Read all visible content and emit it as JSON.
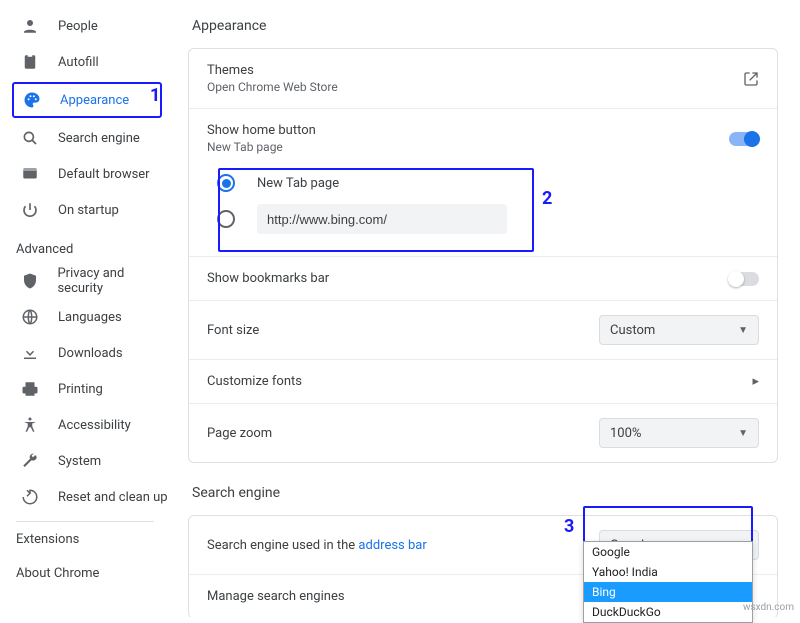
{
  "sidebar": {
    "items": [
      {
        "label": "People"
      },
      {
        "label": "Autofill"
      },
      {
        "label": "Appearance"
      },
      {
        "label": "Search engine"
      },
      {
        "label": "Default browser"
      },
      {
        "label": "On startup"
      }
    ],
    "advanced_label": "Advanced",
    "advanced": [
      {
        "label": "Privacy and security"
      },
      {
        "label": "Languages"
      },
      {
        "label": "Downloads"
      },
      {
        "label": "Printing"
      },
      {
        "label": "Accessibility"
      },
      {
        "label": "System"
      },
      {
        "label": "Reset and clean up"
      }
    ],
    "footer": {
      "extensions": "Extensions",
      "about": "About Chrome"
    }
  },
  "appearance": {
    "title": "Appearance",
    "themes": {
      "title": "Themes",
      "sub": "Open Chrome Web Store"
    },
    "home_button": {
      "title": "Show home button",
      "sub": "New Tab page",
      "opt_newtab": "New Tab page",
      "url_value": "http://www.bing.com/"
    },
    "bookmarks": "Show bookmarks bar",
    "font_size": {
      "label": "Font size",
      "value": "Custom"
    },
    "custom_fonts": "Customize fonts",
    "page_zoom": {
      "label": "Page zoom",
      "value": "100%"
    }
  },
  "search_engine": {
    "title": "Search engine",
    "row_prefix": "Search engine used in the ",
    "row_link": "address bar",
    "value": "Google",
    "manage": "Manage search engines",
    "options": [
      "Google",
      "Yahoo! India",
      "Bing",
      "DuckDuckGo"
    ],
    "highlighted": "Bing"
  },
  "annotations": {
    "n1": "1",
    "n2": "2",
    "n3": "3"
  },
  "watermark": "wsxdn.com"
}
